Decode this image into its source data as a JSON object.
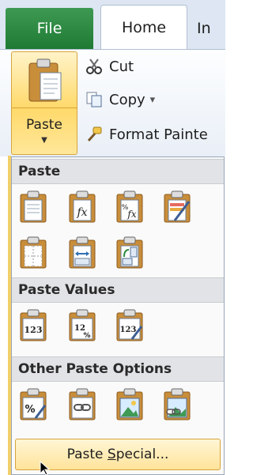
{
  "tabs": {
    "file": "File",
    "home": "Home",
    "insert": "In"
  },
  "clipboard": {
    "paste_label": "Paste",
    "cut_label": "Cut",
    "copy_label": "Copy",
    "copy_arrow": "▾",
    "format_painter_label": "Format Painte"
  },
  "paste_menu": {
    "section_paste": "Paste",
    "section_paste_values": "Paste Values",
    "section_other": "Other Paste Options",
    "paste_special_prefix": "Paste ",
    "paste_special_underlined": "S",
    "paste_special_suffix": "pecial..."
  },
  "colors": {
    "file_tab": "#2a8a40",
    "highlight": "#ffe39a",
    "highlight_border": "#d7a43c"
  }
}
